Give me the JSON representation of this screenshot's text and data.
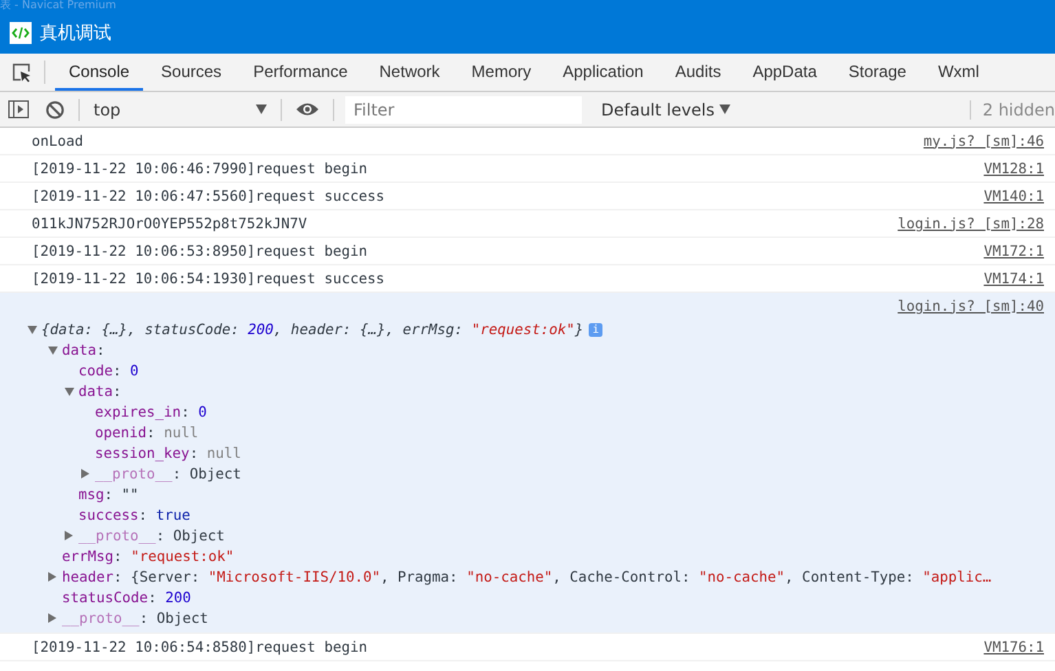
{
  "background_window": {
    "title": "表 - Navicat Premium"
  },
  "window": {
    "title": "真机调试"
  },
  "tabs": [
    {
      "label": "Console",
      "selected": true
    },
    {
      "label": "Sources",
      "selected": false
    },
    {
      "label": "Performance",
      "selected": false
    },
    {
      "label": "Network",
      "selected": false
    },
    {
      "label": "Memory",
      "selected": false
    },
    {
      "label": "Application",
      "selected": false
    },
    {
      "label": "Audits",
      "selected": false
    },
    {
      "label": "AppData",
      "selected": false
    },
    {
      "label": "Storage",
      "selected": false
    },
    {
      "label": "Wxml",
      "selected": false
    }
  ],
  "toolbar": {
    "context": "top",
    "filter": {
      "placeholder": "Filter"
    },
    "levels": "Default levels",
    "hidden_count": "2 hidden"
  },
  "messages": [
    {
      "kind": "log",
      "text": "onLoad",
      "source": "my.js? [sm]:46",
      "hovered": false
    },
    {
      "kind": "log",
      "text": "[2019-11-22 10:06:46:7990]request begin",
      "source": "VM128:1",
      "hovered": false
    },
    {
      "kind": "log",
      "text": "[2019-11-22 10:06:47:5560]request success",
      "source": "VM140:1",
      "hovered": false
    },
    {
      "kind": "log",
      "text": "011kJN752RJOrO0YEP552p8t752kJN7V",
      "source": "login.js? [sm]:28",
      "hovered": false
    },
    {
      "kind": "log",
      "text": "[2019-11-22 10:06:53:8950]request begin",
      "source": "VM172:1",
      "hovered": false
    },
    {
      "kind": "log",
      "text": "[2019-11-22 10:06:54:1930]request success",
      "source": "VM174:1",
      "hovered": false
    },
    {
      "kind": "object",
      "source": "login.js? [sm]:40",
      "hovered": true,
      "tree": {
        "expanded": true,
        "info_badge": "i",
        "summary": [
          {
            "text": "{data: {…}, statusCode: ",
            "kind": "plain"
          },
          {
            "text": "200",
            "kind": "number"
          },
          {
            "text": ", header: {…}, errMsg: ",
            "kind": "plain"
          },
          {
            "text": "\"request:ok\"",
            "kind": "string"
          },
          {
            "text": "}",
            "kind": "plain"
          }
        ],
        "children": [
          {
            "key": "data",
            "kind": "own",
            "expanded": true,
            "value": [
              {
                "text": ":",
                "kind": "plain"
              }
            ],
            "children": [
              {
                "key": "code",
                "kind": "own",
                "value": [
                  {
                    "text": ": ",
                    "kind": "plain"
                  },
                  {
                    "text": "0",
                    "kind": "number"
                  }
                ]
              },
              {
                "key": "data",
                "kind": "own",
                "expanded": true,
                "value": [
                  {
                    "text": ":",
                    "kind": "plain"
                  }
                ],
                "children": [
                  {
                    "key": "expires_in",
                    "kind": "own",
                    "value": [
                      {
                        "text": ": ",
                        "kind": "plain"
                      },
                      {
                        "text": "0",
                        "kind": "number"
                      }
                    ]
                  },
                  {
                    "key": "openid",
                    "kind": "own",
                    "value": [
                      {
                        "text": ": ",
                        "kind": "plain"
                      },
                      {
                        "text": "null",
                        "kind": "null"
                      }
                    ]
                  },
                  {
                    "key": "session_key",
                    "kind": "own",
                    "value": [
                      {
                        "text": ": ",
                        "kind": "plain"
                      },
                      {
                        "text": "null",
                        "kind": "null"
                      }
                    ]
                  },
                  {
                    "key": "__proto__",
                    "kind": "internal",
                    "expanded": false,
                    "value": [
                      {
                        "text": ": Object",
                        "kind": "plain"
                      }
                    ]
                  }
                ]
              },
              {
                "key": "msg",
                "kind": "own",
                "value": [
                  {
                    "text": ": \"\"",
                    "kind": "plain"
                  }
                ]
              },
              {
                "key": "success",
                "kind": "own",
                "value": [
                  {
                    "text": ": ",
                    "kind": "plain"
                  },
                  {
                    "text": "true",
                    "kind": "boolean"
                  }
                ]
              },
              {
                "key": "__proto__",
                "kind": "internal",
                "expanded": false,
                "value": [
                  {
                    "text": ": Object",
                    "kind": "plain"
                  }
                ]
              }
            ]
          },
          {
            "key": "errMsg",
            "kind": "own",
            "value": [
              {
                "text": ": ",
                "kind": "plain"
              },
              {
                "text": "\"request:ok\"",
                "kind": "string"
              }
            ]
          },
          {
            "key": "header",
            "kind": "own",
            "expanded": false,
            "value": [
              {
                "text": ": {Server: ",
                "kind": "plain"
              },
              {
                "text": "\"Microsoft-IIS/10.0\"",
                "kind": "string"
              },
              {
                "text": ", Pragma: ",
                "kind": "plain"
              },
              {
                "text": "\"no-cache\"",
                "kind": "string"
              },
              {
                "text": ", Cache-Control: ",
                "kind": "plain"
              },
              {
                "text": "\"no-cache\"",
                "kind": "string"
              },
              {
                "text": ", Content-Type: ",
                "kind": "plain"
              },
              {
                "text": "\"applic…",
                "kind": "string"
              }
            ]
          },
          {
            "key": "statusCode",
            "kind": "own",
            "value": [
              {
                "text": ": ",
                "kind": "plain"
              },
              {
                "text": "200",
                "kind": "number"
              }
            ]
          },
          {
            "key": "__proto__",
            "kind": "internal",
            "expanded": false,
            "value": [
              {
                "text": ": Object",
                "kind": "plain"
              }
            ]
          }
        ]
      }
    },
    {
      "kind": "log",
      "text": "[2019-11-22 10:06:54:8580]request begin",
      "source": "VM176:1",
      "hovered": false
    }
  ]
}
